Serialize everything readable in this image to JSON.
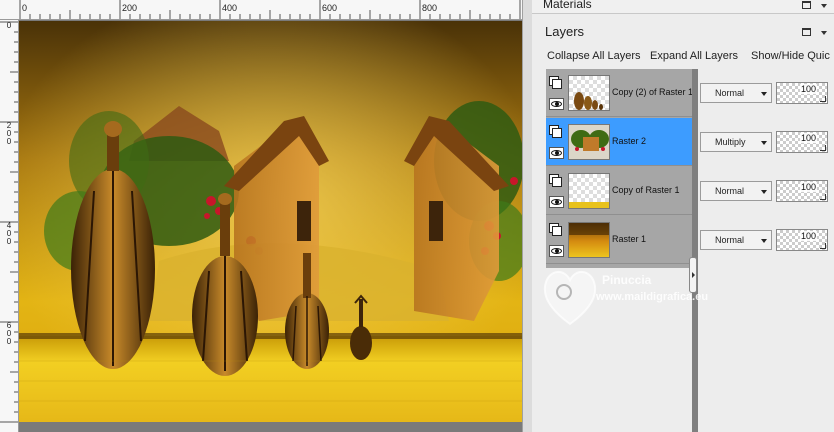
{
  "rulers": {
    "top_labels": [
      "0",
      "200",
      "400",
      "600",
      "800"
    ],
    "left_labels": [
      "0",
      "2\n0\n0",
      "4\n0\n0",
      "6\n0\n0"
    ]
  },
  "materials": {
    "title": "Materials"
  },
  "layers": {
    "title": "Layers",
    "toolbar": {
      "collapse_all": "Collapse All Layers",
      "expand_all": "Expand All Layers",
      "show_hide": "Show/Hide Quic"
    },
    "rows": [
      {
        "name": "Copy (2) of Raster 1",
        "blend": "Normal",
        "opacity": "100",
        "selected": false
      },
      {
        "name": "Raster 2",
        "blend": "Multiply",
        "opacity": "100",
        "selected": true
      },
      {
        "name": "Copy of Raster 1",
        "blend": "Normal",
        "opacity": "100",
        "selected": false
      },
      {
        "name": "Raster 1",
        "blend": "Normal",
        "opacity": "100",
        "selected": false
      }
    ]
  },
  "watermark": {
    "name": "Pinuccia",
    "site": "www.maildigrafica.eu"
  },
  "colors": {
    "selected_row": "#3d9cff",
    "layer_list_bg": "#a6a6a6",
    "canvas_bg": "#7a7a7a"
  },
  "icons": {
    "layer_type": "layer-stack-icon",
    "visibility": "eye-icon",
    "menu": "dropdown-arrow-icon"
  }
}
